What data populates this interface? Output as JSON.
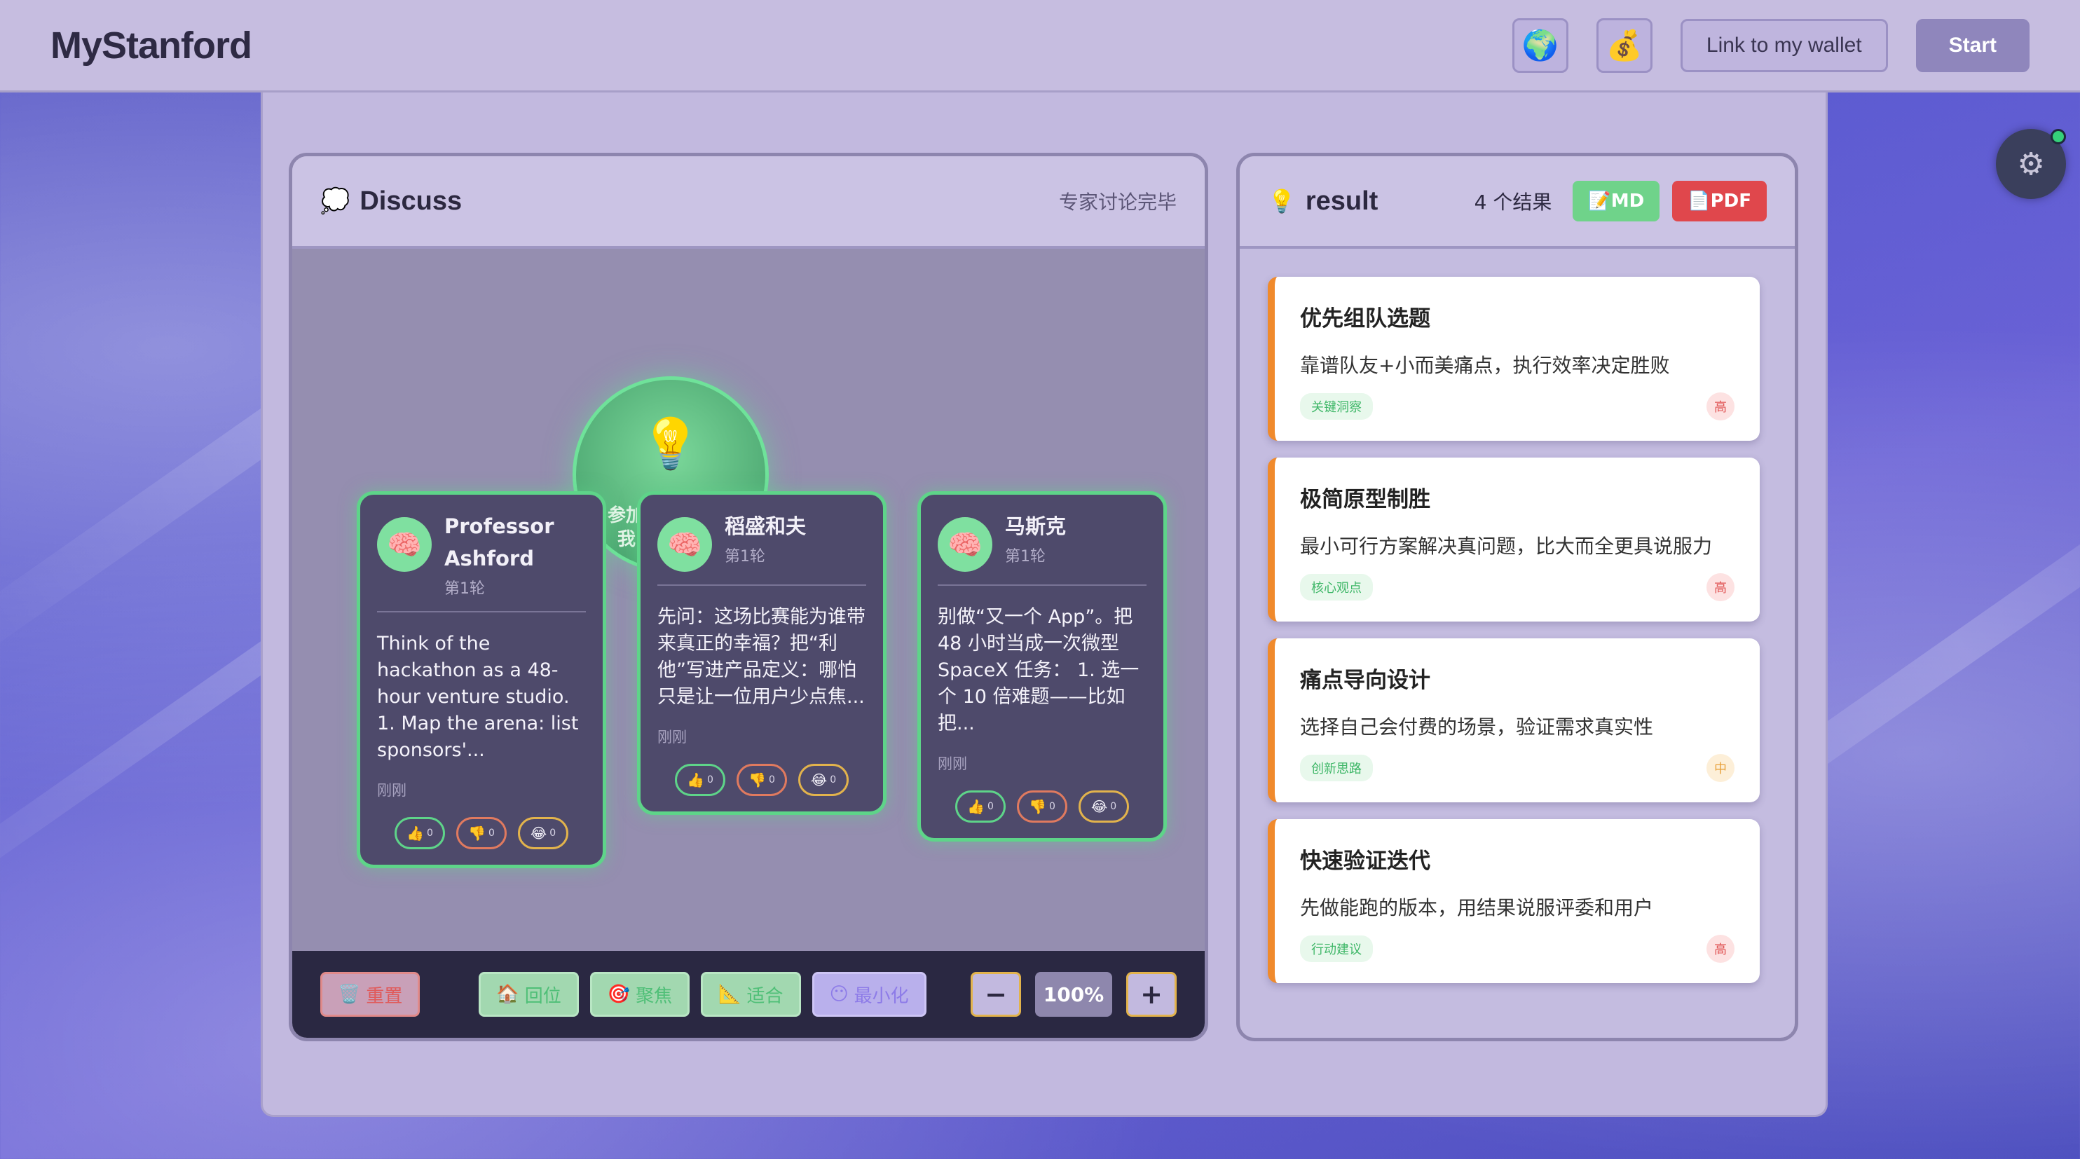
{
  "header": {
    "brand": "MyStanford",
    "globe_icon": "🌍",
    "wallet_icon": "💰",
    "link_wallet_label": "Link to my wallet",
    "start_label": "Start"
  },
  "discuss": {
    "icon": "💭",
    "title": "Discuss",
    "status": "专家讨论完毕",
    "hub_icon": "💡",
    "hub_text_1": "参加",
    "hub_text_2": "我",
    "cards": [
      {
        "avatar": "🧠",
        "name": "Professor Ashford",
        "round": "第1轮",
        "body": "Think of the hackathon as a 48-hour venture studio. 1. Map the arena: list sponsors'...",
        "time": "刚刚",
        "up": "👍",
        "up_count": "0",
        "down": "👎",
        "down_count": "0",
        "laugh": "😂",
        "laugh_count": "0"
      },
      {
        "avatar": "🧠",
        "name": "稻盛和夫",
        "round": "第1轮",
        "body": "先问：这场比赛能为谁带来真正的幸福？把“利他”写进产品定义：哪怕只是让一位用户少点焦...",
        "time": "刚刚",
        "up": "👍",
        "up_count": "0",
        "down": "👎",
        "down_count": "0",
        "laugh": "😂",
        "laugh_count": "0"
      },
      {
        "avatar": "🧠",
        "name": "马斯克",
        "round": "第1轮",
        "body": "别做“又一个 App”。把 48 小时当成一次微型 SpaceX 任务： 1. 选一个 10 倍难题——比如把...",
        "time": "刚刚",
        "up": "👍",
        "up_count": "0",
        "down": "👎",
        "down_count": "0",
        "laugh": "😂",
        "laugh_count": "0"
      }
    ],
    "toolbar": {
      "reset_icon": "🗑️",
      "reset_label": "重置",
      "home_icon": "🏠",
      "home_label": "回位",
      "focus_icon": "🎯",
      "focus_label": "聚焦",
      "fit_icon": "📐",
      "fit_label": "适合",
      "minimize_icon": "😶",
      "minimize_label": "最小化",
      "zoom_out": "−",
      "zoom_value": "100%",
      "zoom_in": "+"
    }
  },
  "result": {
    "icon": "💡",
    "title": "result",
    "count": "4 个结果",
    "md_icon": "📝",
    "md_label": "MD",
    "pdf_icon": "📄",
    "pdf_label": "PDF",
    "items": [
      {
        "title": "优先组队选题",
        "desc": "靠谱队友+小而美痛点，执行效率决定胜败",
        "tag": "关键洞察",
        "level": "高"
      },
      {
        "title": "极简原型制胜",
        "desc": "最小可行方案解决真问题，比大而全更具说服力",
        "tag": "核心观点",
        "level": "高"
      },
      {
        "title": "痛点导向设计",
        "desc": "选择自己会付费的场景，验证需求真实性",
        "tag": "创新思路",
        "level": "中"
      },
      {
        "title": "快速验证迭代",
        "desc": "先做能跑的版本，用结果说服评委和用户",
        "tag": "行动建议",
        "level": "高"
      }
    ]
  },
  "settings": {
    "gear_icon": "⚙"
  },
  "colors": {
    "accent_green": "#5ed489",
    "accent_orange": "#f08a2c",
    "pdf_red": "#e0474c",
    "md_green": "#6fd38a"
  }
}
